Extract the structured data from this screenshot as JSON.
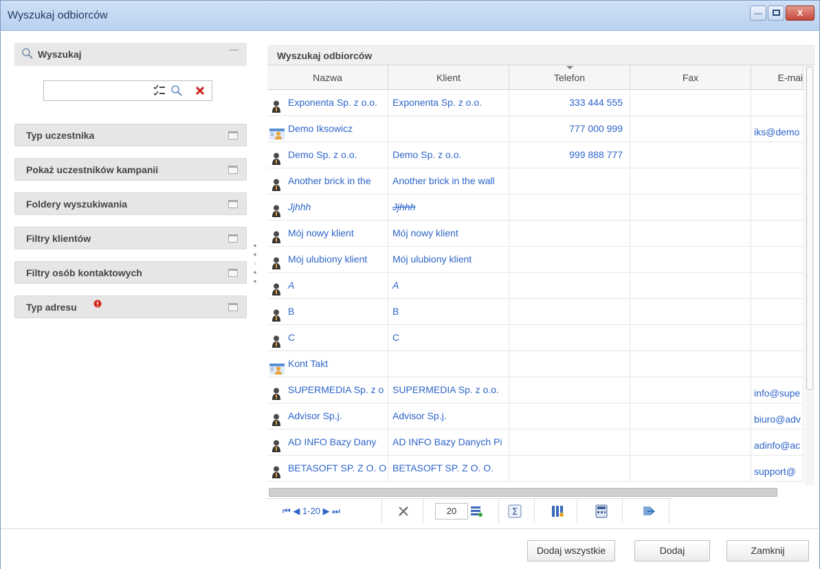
{
  "window": {
    "title": "Wyszukaj odbiorców",
    "minimize_label": "—",
    "maximize_label": "",
    "close_label": "X"
  },
  "search_section": {
    "title": "Wyszukaj",
    "input_value": ""
  },
  "accordion": [
    {
      "label": "Typ uczestnika"
    },
    {
      "label": "Pokaż uczestników kampanii"
    },
    {
      "label": "Foldery wyszukiwania"
    },
    {
      "label": "Filtry klientów"
    },
    {
      "label": "Filtry osób kontaktowych"
    },
    {
      "label": "Typ adresu"
    }
  ],
  "grid": {
    "title": "Wyszukaj odbiorców",
    "columns": [
      "Nazwa",
      "Klient",
      "Telefon",
      "Fax",
      "E-mai"
    ],
    "rows": [
      {
        "icon": "person",
        "name": "Exponenta Sp. z o.o.",
        "client": "Exponenta Sp. z o.o.",
        "phone": "333 444 555",
        "fax": "",
        "email": ""
      },
      {
        "icon": "contact",
        "name": "Demo Iksowicz",
        "client": "",
        "phone": "777 000 999",
        "fax": "",
        "email": "iks@demo"
      },
      {
        "icon": "person",
        "name": "Demo Sp. z o.o.",
        "client": "Demo Sp. z o.o.",
        "phone": "999 888 777",
        "fax": "",
        "email": ""
      },
      {
        "icon": "person",
        "name": "Another brick in the",
        "client": "Another brick in the wall",
        "phone": "",
        "fax": "",
        "email": ""
      },
      {
        "icon": "person",
        "name": "Jjhhh",
        "client": "Jjhhh",
        "phone": "",
        "fax": "",
        "email": "",
        "italic": true,
        "strike_client": true
      },
      {
        "icon": "person",
        "name": "Mój nowy klient",
        "client": "Mój nowy klient",
        "phone": "",
        "fax": "",
        "email": ""
      },
      {
        "icon": "person",
        "name": "Mój ulubiony klient",
        "client": "Mój ulubiony klient",
        "phone": "",
        "fax": "",
        "email": ""
      },
      {
        "icon": "person",
        "name": "A",
        "client": "A",
        "phone": "",
        "fax": "",
        "email": "",
        "italic": true
      },
      {
        "icon": "person",
        "name": "B",
        "client": "B",
        "phone": "",
        "fax": "",
        "email": ""
      },
      {
        "icon": "person",
        "name": "C",
        "client": "C",
        "phone": "",
        "fax": "",
        "email": ""
      },
      {
        "icon": "contact",
        "name": "Kont Takt",
        "client": "",
        "phone": "",
        "fax": "",
        "email": ""
      },
      {
        "icon": "person",
        "name": "SUPERMEDIA Sp. z o",
        "client": "SUPERMEDIA Sp. z o.o.",
        "phone": "",
        "fax": "",
        "email": "info@supe"
      },
      {
        "icon": "person",
        "name": "Advisor Sp.j.",
        "client": "Advisor Sp.j.",
        "phone": "",
        "fax": "",
        "email": "biuro@adv"
      },
      {
        "icon": "person",
        "name": "AD INFO Bazy Dany",
        "client": "AD INFO Bazy Danych Pi",
        "phone": "",
        "fax": "",
        "email": "adinfo@ac"
      },
      {
        "icon": "person",
        "name": "BETASOFT SP. Z O. O",
        "client": "BETASOFT SP. Z O. O.",
        "phone": "",
        "fax": "",
        "email": "support@"
      }
    ]
  },
  "toolbar": {
    "page_range": "1-20",
    "page_size": "20"
  },
  "footer": {
    "add_all_label": "Dodaj wszystkie",
    "add_label": "Dodaj",
    "close_label": "Zamknij"
  }
}
